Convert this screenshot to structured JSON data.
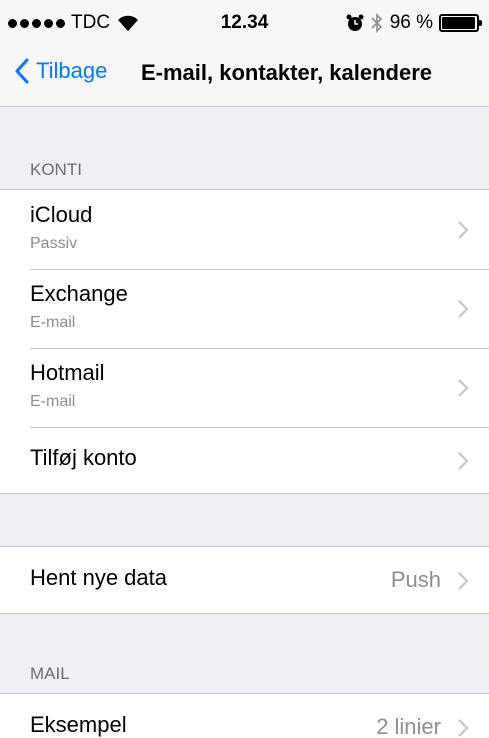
{
  "status_bar": {
    "carrier": "TDC",
    "time": "12.34",
    "battery_text": "96 %",
    "battery_level": 0.96,
    "icons": [
      "signal-dots",
      "wifi-icon",
      "alarm-icon",
      "bluetooth-icon",
      "battery-icon"
    ]
  },
  "nav": {
    "back_label": "Tilbage",
    "title": "E-mail, kontakter, kalendere"
  },
  "sections": {
    "accounts_header": "KONTI",
    "mail_header": "MAIL"
  },
  "accounts": [
    {
      "title": "iCloud",
      "subtitle": "Passiv"
    },
    {
      "title": "Exchange",
      "subtitle": "E-mail"
    },
    {
      "title": "Hotmail",
      "subtitle": "E-mail"
    }
  ],
  "add_account": {
    "title": "Tilføj konto"
  },
  "fetch": {
    "title": "Hent nye data",
    "value": "Push"
  },
  "mail_preview": {
    "title": "Eksempel",
    "value": "2 linier"
  },
  "colors": {
    "accent": "#007aff",
    "background": "#efeff4",
    "separator": "#c8c7cc",
    "secondary_text": "#8e8e93"
  }
}
